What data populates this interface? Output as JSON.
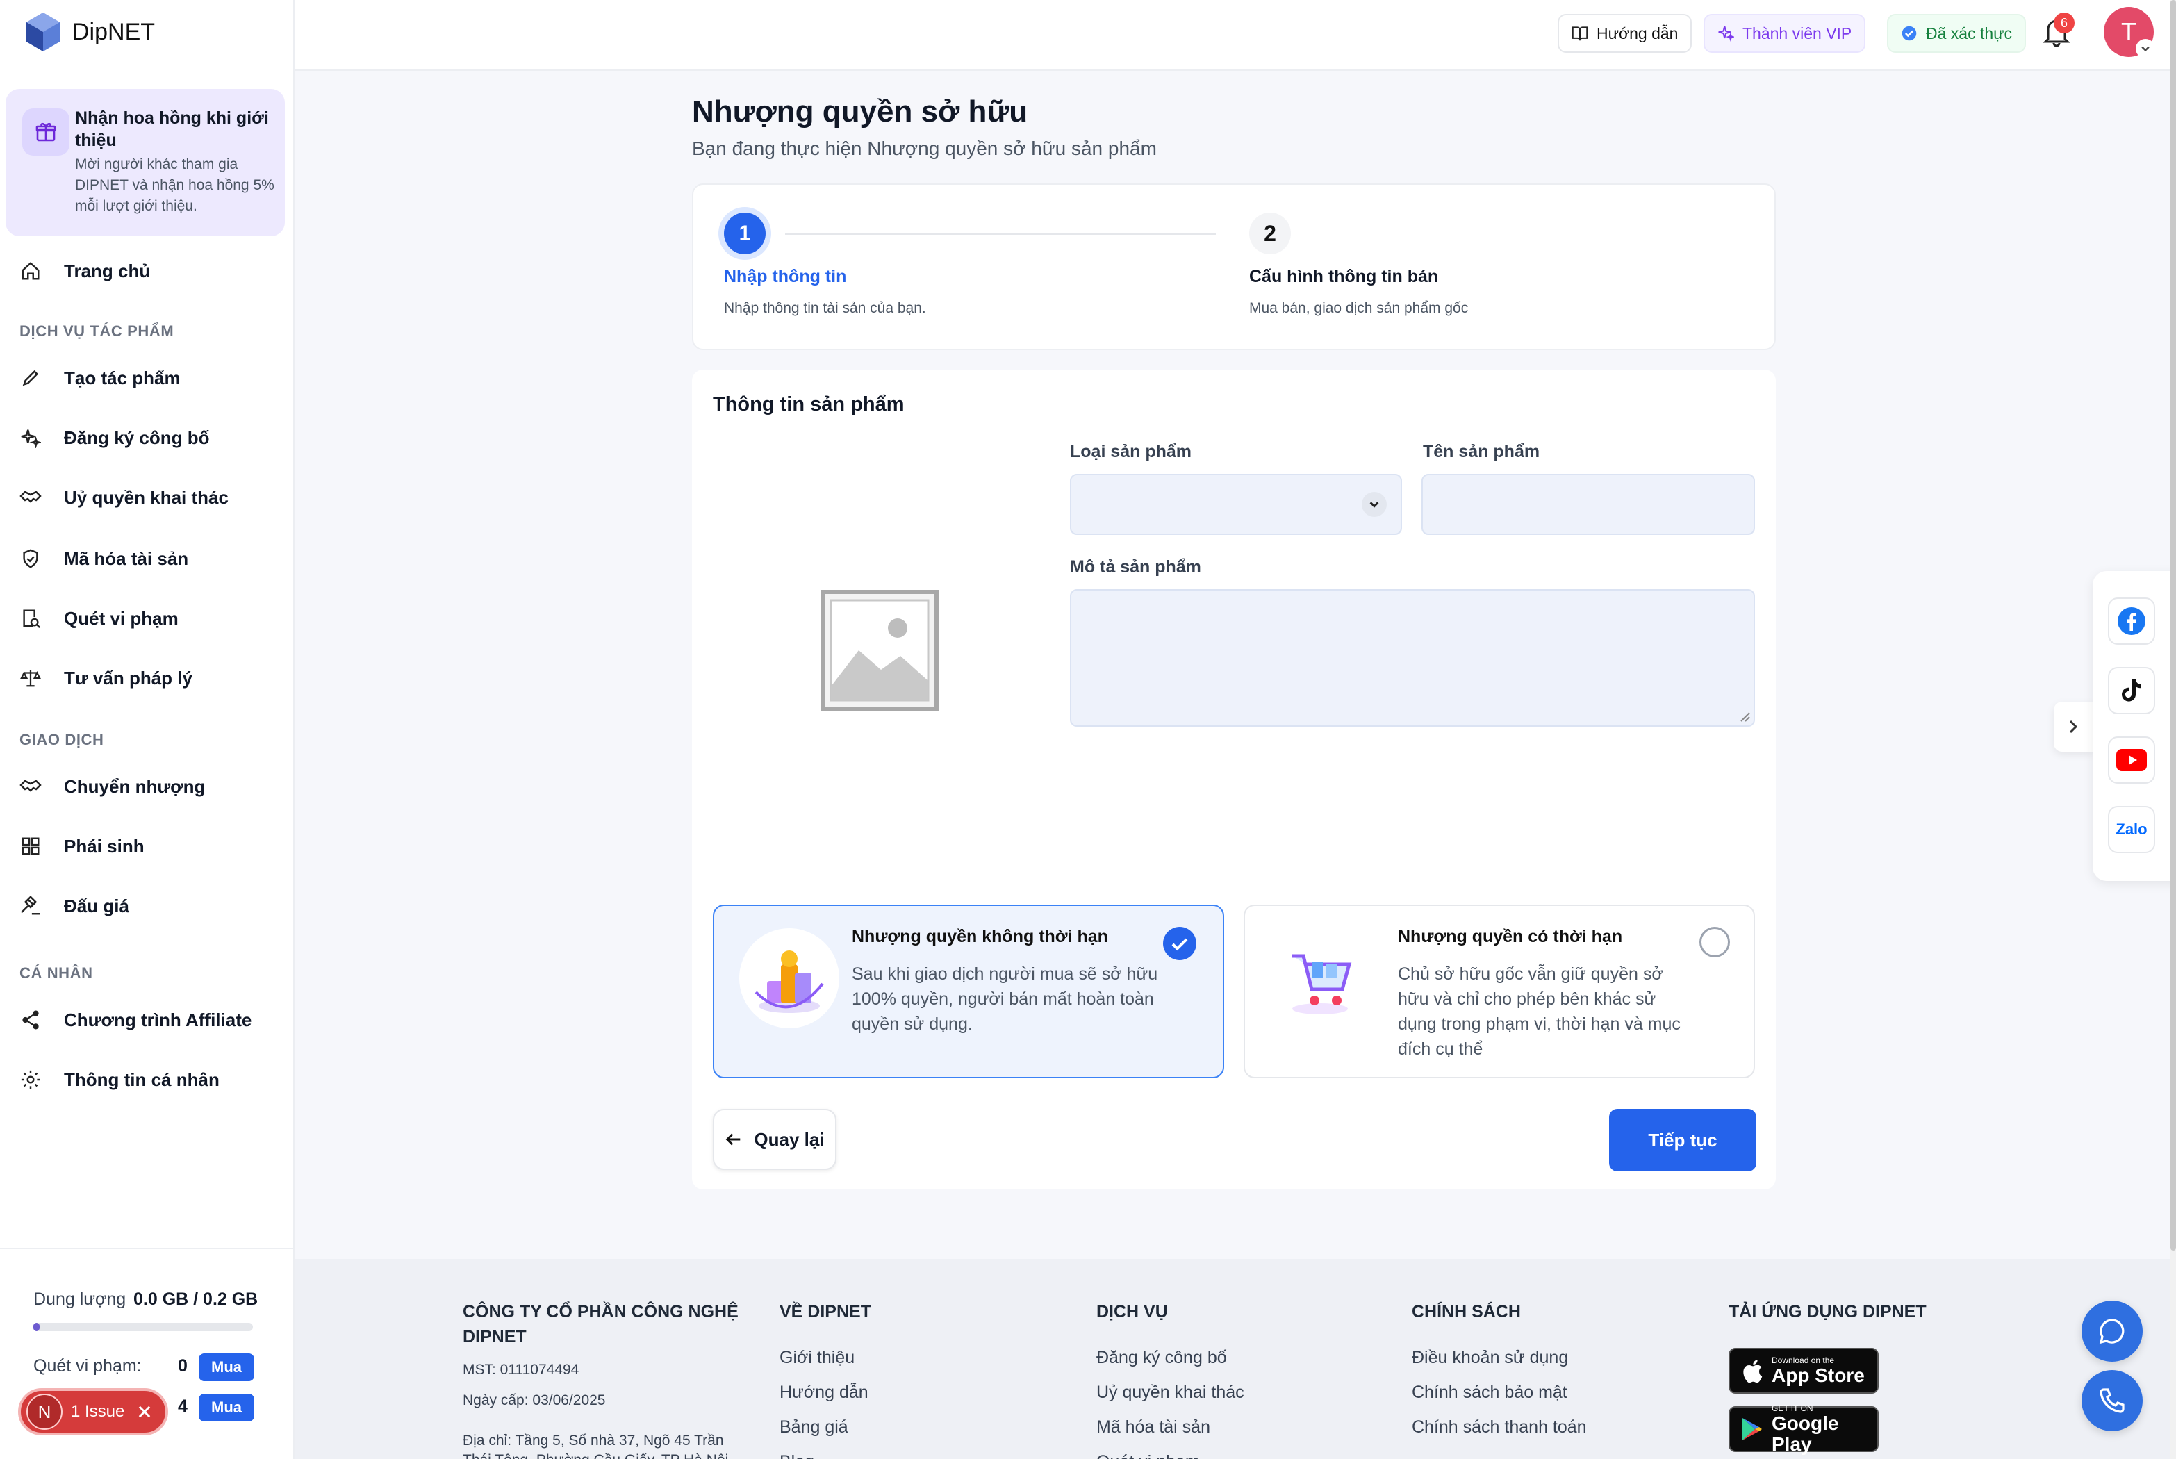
{
  "app": {
    "brand": "DipNET"
  },
  "promo": {
    "title": "Nhận hoa hồng khi giới thiệu",
    "desc": "Mời người khác tham gia DIPNET và nhận hoa hồng 5% mỗi lượt giới thiệu."
  },
  "nav": {
    "home": "Trang chủ",
    "section1": "DỊCH VỤ TÁC PHẨM",
    "create": "Tạo tác phẩm",
    "register": "Đăng ký công bố",
    "authorize": "Uỷ quyền khai thác",
    "tokenize": "Mã hóa tài sản",
    "scan": "Quét vi phạm",
    "legal": "Tư vấn pháp lý",
    "section2": "GIAO DỊCH",
    "transfer": "Chuyển nhượng",
    "derivative": "Phái sinh",
    "auction": "Đấu giá",
    "section3": "CÁ NHÂN",
    "affiliate": "Chương trình Affiliate",
    "profile": "Thông tin cá nhân"
  },
  "storage": {
    "label": "Dung lượng",
    "value": "0.0 GB / 0.2 GB",
    "fill_fraction": 0.02,
    "scan_label": "Quét vi phạm:",
    "scan_count": "0",
    "second_count": "4",
    "buy_label": "Mua"
  },
  "issue": {
    "letter": "N",
    "label": "1 Issue"
  },
  "header": {
    "guide": "Hướng dẫn",
    "vip": "Thành viên VIP",
    "verified": "Đã xác thực",
    "notif_count": "6",
    "avatar_letter": "T"
  },
  "page": {
    "title": "Nhượng quyền sở hữu",
    "subtitle": "Bạn đang thực hiện Nhượng quyền sở hữu sản phẩm"
  },
  "steps": [
    {
      "num": "1",
      "title": "Nhập thông tin",
      "desc": "Nhập thông tin tài sản của bạn."
    },
    {
      "num": "2",
      "title": "Cấu hình thông tin bán",
      "desc": "Mua bán, giao dịch sản phẩm gốc"
    }
  ],
  "form": {
    "section_title": "Thông tin sản phẩm",
    "type_label": "Loại sản phẩm",
    "type_value": "",
    "name_label": "Tên sản phẩm",
    "name_value": "",
    "desc_label": "Mô tả sản phẩm",
    "desc_value": ""
  },
  "options": [
    {
      "title": "Nhượng quyền không thời hạn",
      "desc": "Sau khi giao dịch người mua sẽ sở hữu 100% quyền, người bán mất hoàn toàn quyền sử dụng.",
      "selected": true
    },
    {
      "title": "Nhượng quyền có thời hạn",
      "desc": "Chủ sở hữu gốc vẫn giữ quyền sở hữu và chỉ cho phép bên khác sử dụng trong phạm vi, thời hạn và mục đích cụ thể",
      "selected": false
    }
  ],
  "actions": {
    "back": "Quay lại",
    "next": "Tiếp tục"
  },
  "social": {
    "zalo": "Zalo"
  },
  "footer": {
    "company": "CÔNG TY CỔ PHẦN CÔNG NGHỆ DIPNET",
    "tax": "MST: 0111074494",
    "issued": "Ngày cấp: 03/06/2025",
    "address": "Địa chỉ: Tầng 5, Số nhà 37, Ngõ 45 Trần Thái Tông, Phường Cầu Giấy, TP Hà Nội",
    "col1": {
      "title": "VỀ DIPNET",
      "links": [
        "Giới thiệu",
        "Hướng dẫn",
        "Bảng giá",
        "Blog"
      ]
    },
    "col2": {
      "title": "DỊCH VỤ",
      "links": [
        "Đăng ký công bố",
        "Uỷ quyền khai thác",
        "Mã hóa tài sản",
        "Quét vi phạm"
      ]
    },
    "col3": {
      "title": "CHÍNH SÁCH",
      "links": [
        "Điều khoản sử dụng",
        "Chính sách bảo mật",
        "Chính sách thanh toán"
      ]
    },
    "col4": {
      "title": "TẢI ỨNG DỤNG DIPNET",
      "appstore_small": "Download on the",
      "appstore_big": "App Store",
      "gplay_small": "GET IT ON",
      "gplay_big": "Google Play"
    }
  },
  "colors": {
    "primary": "#2563eb",
    "vip": "#7c3aed",
    "verified": "#15803d",
    "badge": "#ef4444"
  }
}
